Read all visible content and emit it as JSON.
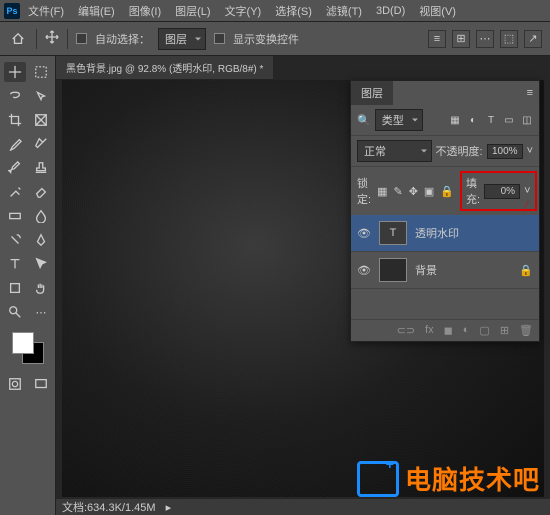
{
  "app": {
    "name": "Ps"
  },
  "menu": {
    "file": "文件(F)",
    "edit": "编辑(E)",
    "image": "图像(I)",
    "layer": "图层(L)",
    "text": "文字(Y)",
    "select": "选择(S)",
    "filter": "滤镜(T)",
    "view3d": "3D(D)",
    "view": "视图(V)"
  },
  "options": {
    "auto_select": "自动选择：",
    "auto_select_target": "图层",
    "show_transform": "显示变换控件"
  },
  "document": {
    "tab": "黑色背景.jpg @ 92.8% (透明水印, RGB/8#) *",
    "doc_size": "文档:634.3K/1.45M"
  },
  "layers": {
    "title": "图层",
    "search_label": "类型",
    "blend_mode": "正常",
    "opacity_label": "不透明度:",
    "opacity_value": "100%",
    "lock_label": "锁定:",
    "fill_label": "填充:",
    "fill_value": "0%",
    "items": [
      {
        "name": "透明水印",
        "type": "text"
      },
      {
        "name": "背景",
        "type": "image",
        "locked": true
      }
    ]
  },
  "watermark": {
    "text": "电脑技术吧"
  }
}
